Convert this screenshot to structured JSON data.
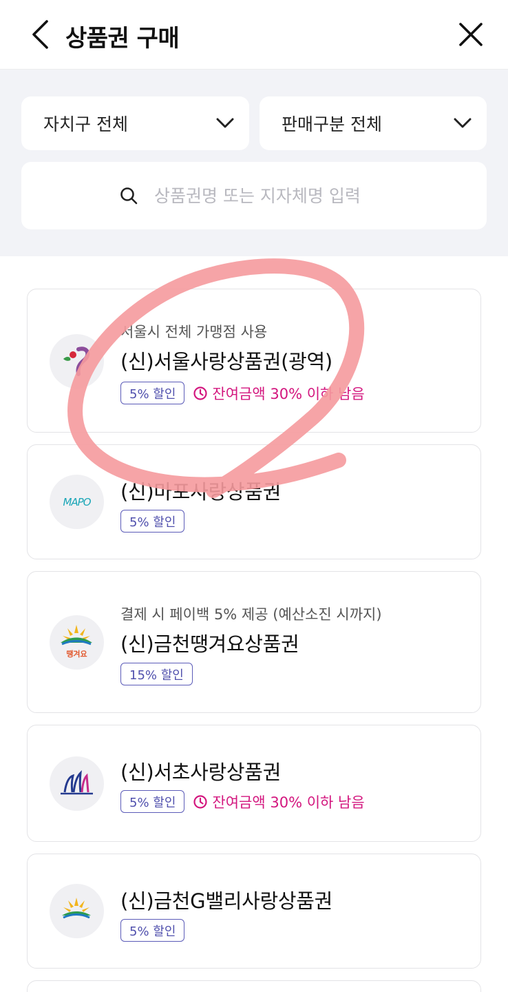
{
  "header": {
    "title": "상품권 구매",
    "back_icon": "chevron-left-icon",
    "close_icon": "close-icon"
  },
  "filters": {
    "district": {
      "label": "자치구 전체",
      "icon": "chevron-down-icon"
    },
    "sale_type": {
      "label": "판매구분 전체",
      "icon": "chevron-down-icon"
    },
    "search": {
      "placeholder": "상품권명 또는 지자체명 입력",
      "value": "",
      "icon": "search-icon"
    }
  },
  "vouchers": [
    {
      "subtitle": "서울시 전체 가맹점 사용",
      "name": "(신)서울사랑상품권(광역)",
      "discount": "5% 할인",
      "warning": "잔여금액 30% 이하 남음",
      "logo": "seoul-logo-icon"
    },
    {
      "subtitle": "",
      "name": "(신)마포사랑상품권",
      "discount": "5% 할인",
      "warning": "",
      "logo": "mapo-logo-icon",
      "logo_text": "MAPO"
    },
    {
      "subtitle": "결제 시 페이백 5% 제공 (예산소진 시까지)",
      "name": "(신)금천땡겨요상품권",
      "discount": "15% 할인",
      "warning": "",
      "logo": "geumcheon-ddanggyeoyo-logo-icon",
      "logo_text": "땡겨요"
    },
    {
      "subtitle": "",
      "name": "(신)서초사랑상품권",
      "discount": "5% 할인",
      "warning": "잔여금액 30% 이하 남음",
      "logo": "seocho-logo-icon"
    },
    {
      "subtitle": "",
      "name": "(신)금천G밸리사랑상품권",
      "discount": "5% 할인",
      "warning": "",
      "logo": "geumcheon-gvalley-logo-icon"
    }
  ],
  "colors": {
    "accent": "#5050ad",
    "warning": "#d3167e",
    "background": "#f2f3f7",
    "annotation": "#f59a9d"
  }
}
